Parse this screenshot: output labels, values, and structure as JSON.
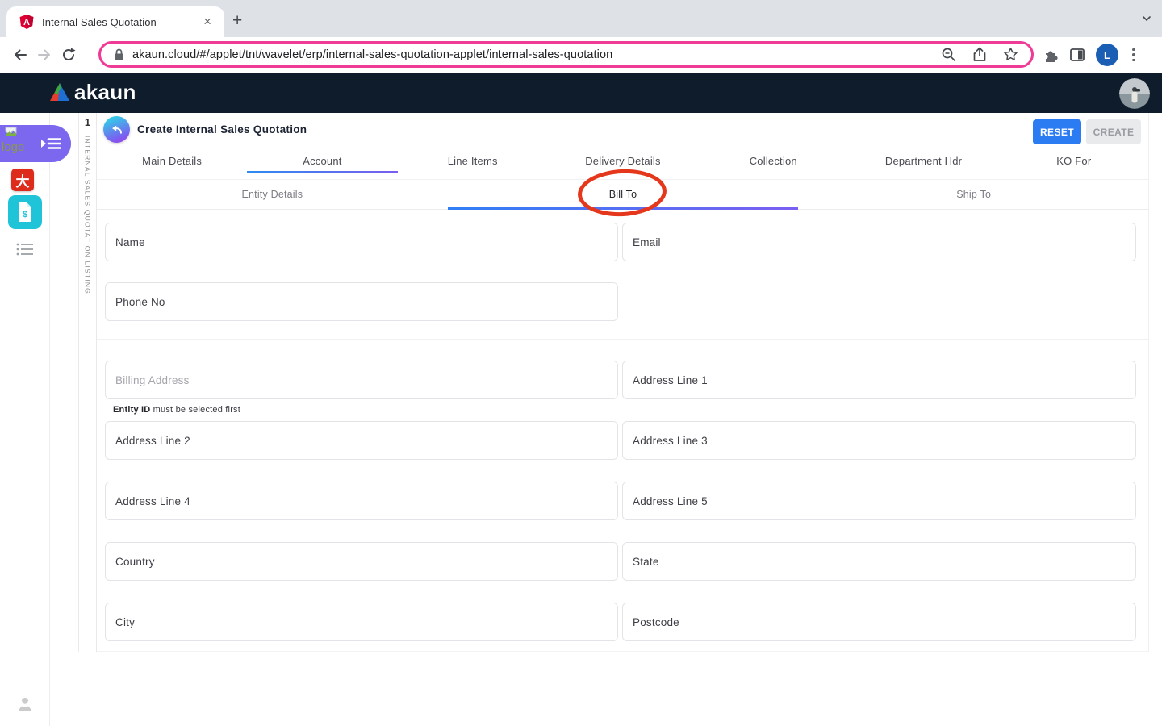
{
  "browser": {
    "tab_title": "Internal Sales Quotation",
    "close_glyph": "×",
    "new_tab_glyph": "+",
    "url": "akaun.cloud/#/applet/tnt/wavelet/erp/internal-sales-quotation-applet/internal-sales-quotation",
    "profile_initial": "L"
  },
  "header": {
    "brand": "akaun"
  },
  "sidebar": {
    "logo_alt": "logo",
    "app_icon_glyph": "大",
    "doc_icon_glyph": "$",
    "listing_index": "1",
    "listing_label": "INTERNAL SALES QUOTATION LISTING"
  },
  "page": {
    "title": "Create Internal Sales Quotation",
    "actions": {
      "reset": "RESET",
      "create": "CREATE"
    },
    "tabs": [
      {
        "label": "Main Details",
        "active": false
      },
      {
        "label": "Account",
        "active": true
      },
      {
        "label": "Line Items",
        "active": false
      },
      {
        "label": "Delivery Details",
        "active": false
      },
      {
        "label": "Collection",
        "active": false
      },
      {
        "label": "Department Hdr",
        "active": false
      },
      {
        "label": "KO For",
        "active": false
      }
    ],
    "subtabs": [
      {
        "label": "Entity Details",
        "active": false
      },
      {
        "label": "Bill To",
        "active": true
      },
      {
        "label": "Ship To",
        "active": false
      }
    ],
    "helper_bold": "Entity ID",
    "helper_rest": " must be selected first",
    "fields": {
      "name": "Name",
      "email": "Email",
      "phone": "Phone No",
      "billing_address": "Billing Address",
      "address1": "Address Line 1",
      "address2": "Address Line 2",
      "address3": "Address Line 3",
      "address4": "Address Line 4",
      "address5": "Address Line 5",
      "country": "Country",
      "state": "State",
      "city": "City",
      "postcode": "Postcode"
    }
  },
  "colors": {
    "accent_blue": "#2b7bf3",
    "underline_gradient": [
      "#2e8bf0",
      "#7a5ff0"
    ],
    "annotation_red": "#e5371c",
    "url_highlight_pink": "#ef3a96",
    "header_navy": "#0e1c2c",
    "sidebar_purple": "#7b68ee",
    "sidebar_cyan": "#1fc4d9",
    "sidebar_red": "#dd2b1c"
  }
}
